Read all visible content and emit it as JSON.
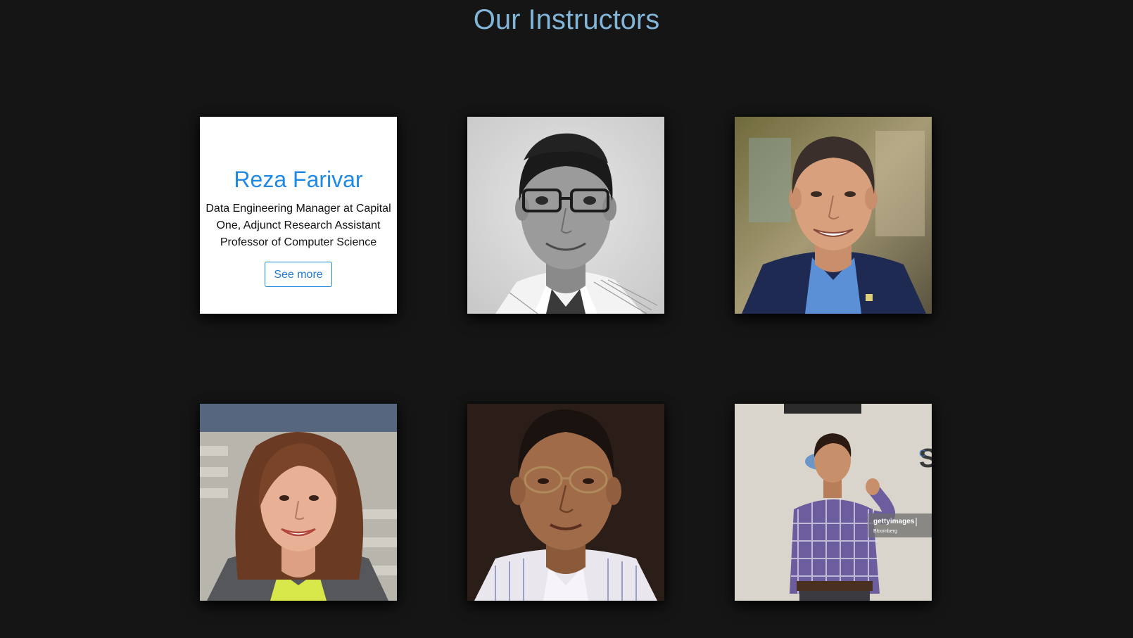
{
  "page": {
    "title": "Our Instructors"
  },
  "instructors": [
    {
      "name": "Reza Farivar",
      "role": "Data Engineering Manager at Capital One, Adjunct Research Assistant Professor of Computer Science",
      "button_label": "See more",
      "state": "hover-info"
    },
    {
      "state": "photo",
      "photo": "portrait-man-glasses-grayscale"
    },
    {
      "state": "photo",
      "photo": "portrait-man-blue-blazer"
    },
    {
      "state": "photo",
      "photo": "portrait-woman-long-hair"
    },
    {
      "state": "photo",
      "photo": "portrait-man-glasses-striped-shirt"
    },
    {
      "state": "photo",
      "photo": "portrait-man-speaking-on-stage",
      "watermark": "gettyimages",
      "watermark_credit": "Bloomberg"
    }
  ],
  "colors": {
    "background": "#151515",
    "title": "#82b6d8",
    "name_accent": "#1f8ae6"
  }
}
